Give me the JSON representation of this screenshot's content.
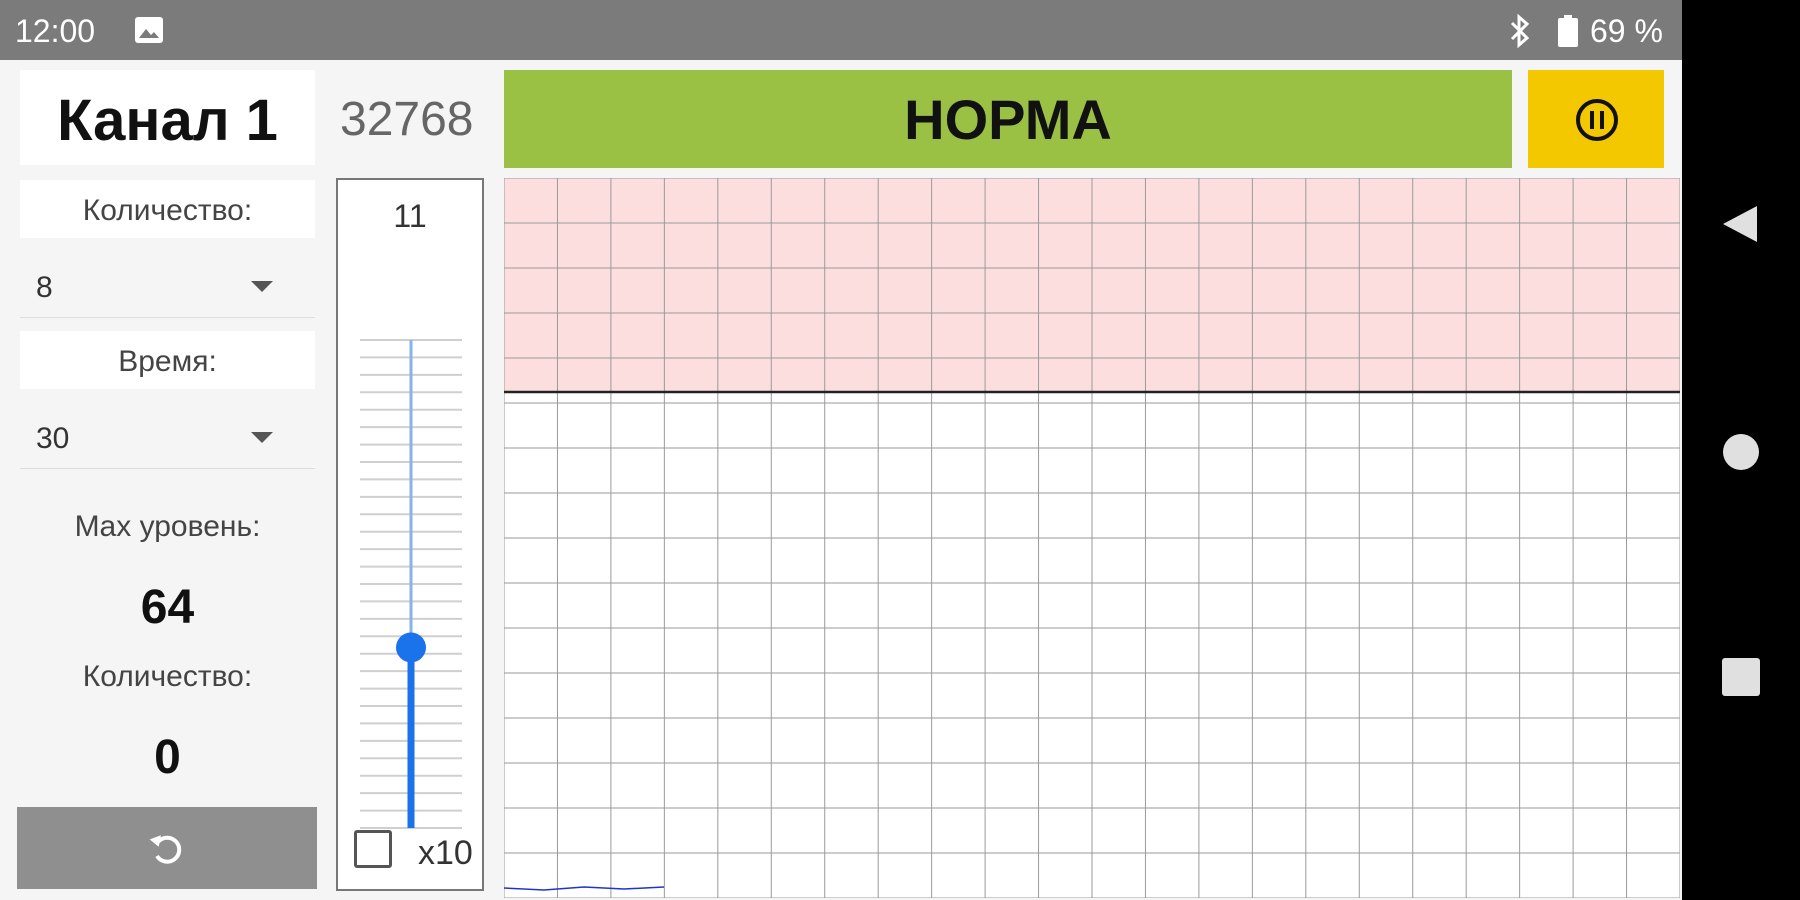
{
  "status_bar": {
    "time": "12:00",
    "battery": "69 %",
    "icons": [
      "image-icon",
      "bluetooth-icon",
      "battery-icon"
    ]
  },
  "channel": {
    "title": "Канал 1"
  },
  "counter": {
    "value": "32768"
  },
  "quantity_setting": {
    "label": "Количество:",
    "selected": "8"
  },
  "time_setting": {
    "label": "Время:",
    "selected": "30"
  },
  "max_level": {
    "label": "Max уровень:",
    "value": "64"
  },
  "count": {
    "label": "Количество:",
    "value": "0"
  },
  "reset_button": {
    "icon": "refresh-icon"
  },
  "slider": {
    "value": "11",
    "level_fraction": 0.37,
    "x10_label": "x10",
    "x10_checked": false
  },
  "status_banner": {
    "text": "НОРМА",
    "color": "#9ac143"
  },
  "pause_button": {
    "icon": "pause-icon",
    "color": "#f3c800"
  },
  "chart_data": {
    "type": "line",
    "threshold_zone_color": "#fddede",
    "grid": true,
    "series": []
  },
  "nav_bar": {
    "icons": [
      "back-icon",
      "home-icon",
      "recents-icon"
    ]
  }
}
